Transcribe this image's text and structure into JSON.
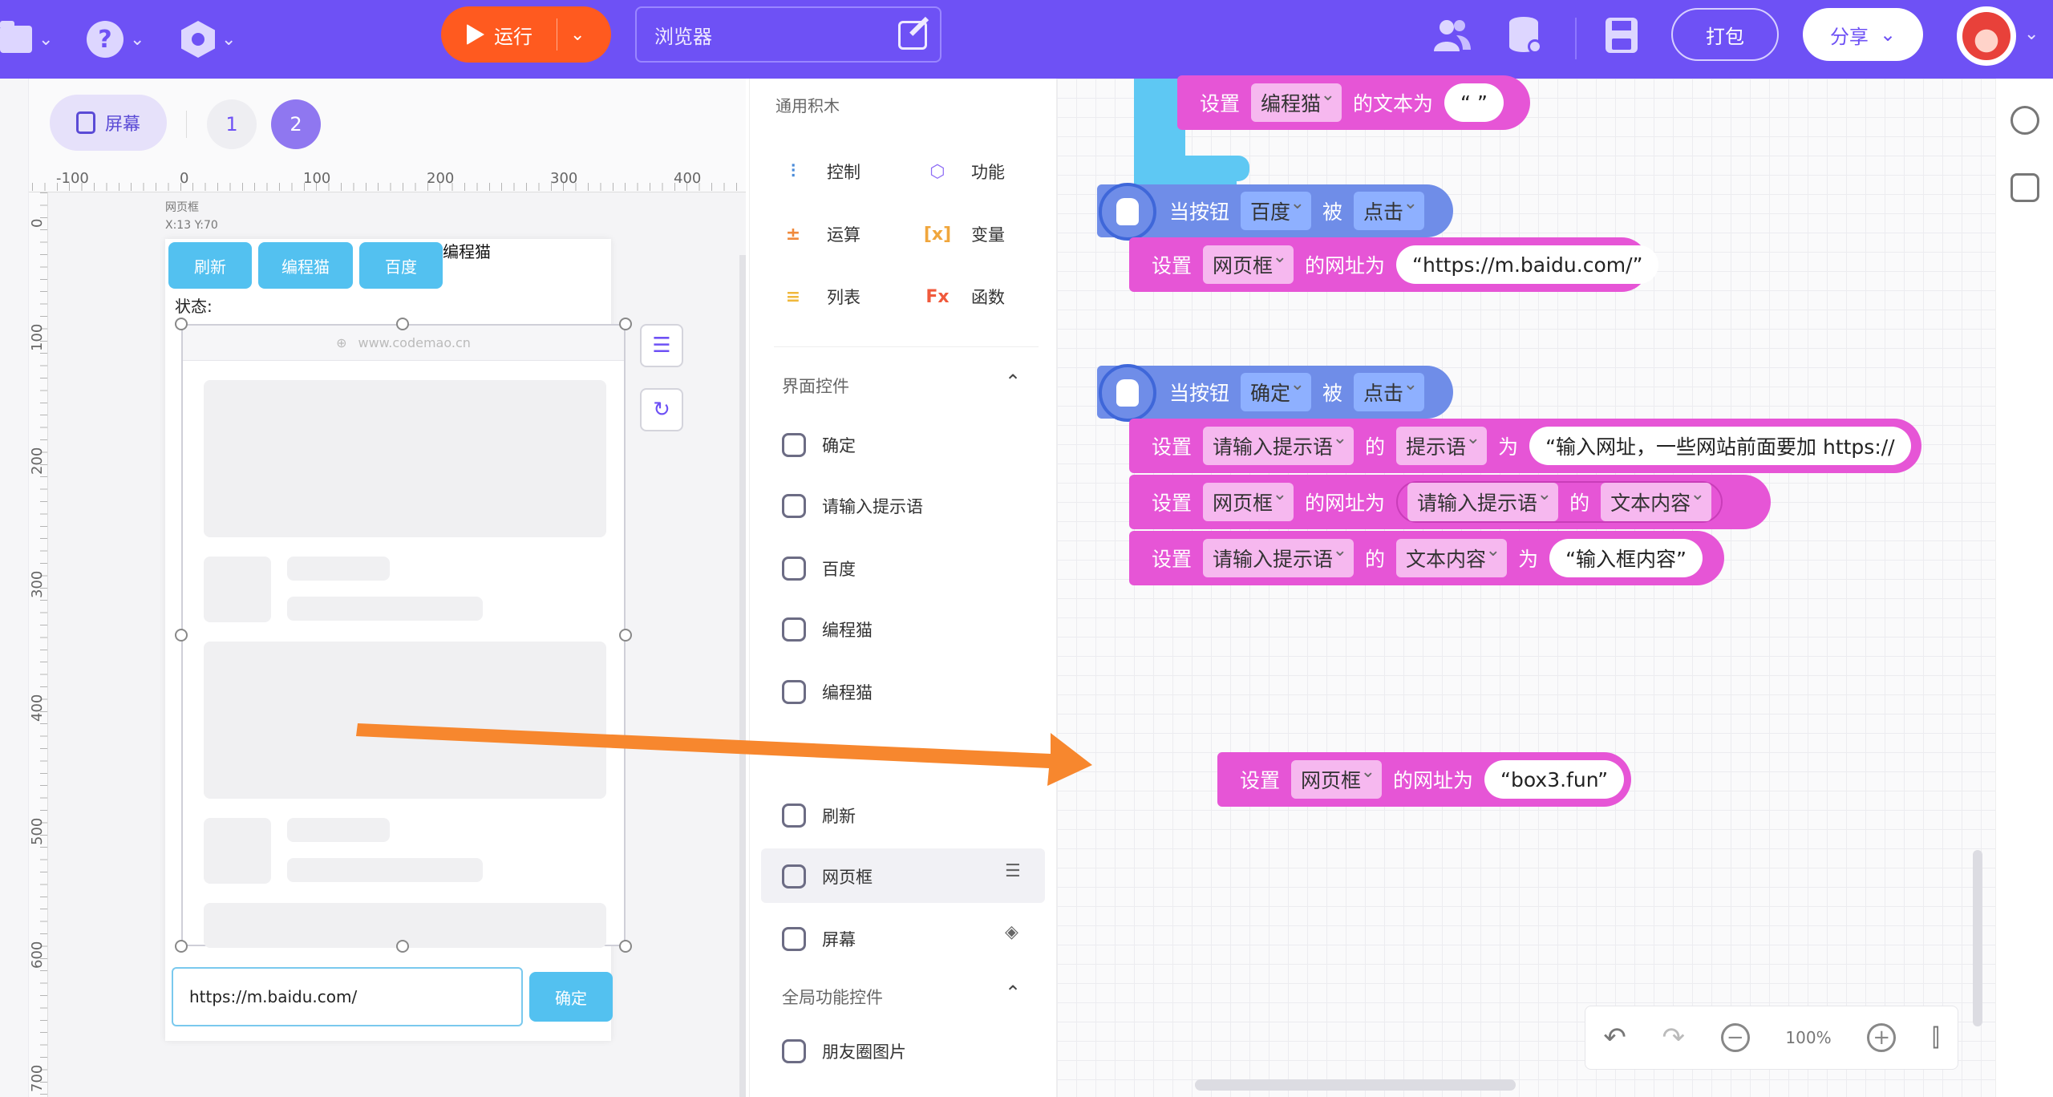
{
  "topbar": {
    "run_label": "运行",
    "browser_title": "浏览器",
    "pack_label": "打包",
    "share_label": "分享"
  },
  "stage": {
    "screen_label": "屏幕",
    "pages": [
      "1",
      "2"
    ],
    "ruler_h": [
      "-100",
      "0",
      "100",
      "200",
      "300",
      "400"
    ],
    "ruler_v": [
      "0",
      "100",
      "200",
      "300",
      "400",
      "500",
      "600",
      "700"
    ],
    "selected_name": "网页框",
    "selected_coord": "X:13 Y:70",
    "buttons": [
      "刷新",
      "编程猫",
      "百度"
    ],
    "label_cat": "编程猫",
    "label_status": "状态:",
    "webview_url": "www.codemao.cn",
    "input_value": "https://m.baidu.com/",
    "ok_label": "确定"
  },
  "palette": {
    "general_title": "通用积木",
    "categories": [
      {
        "label": "控制",
        "color": "#4a8bd9"
      },
      {
        "label": "功能",
        "color": "#8d6cf5"
      },
      {
        "label": "运算",
        "color": "#f08a3c"
      },
      {
        "label": "变量",
        "color": "#f0a63c"
      },
      {
        "label": "列表",
        "color": "#f0b83c"
      },
      {
        "label": "函数",
        "color": "#f05a3c"
      }
    ],
    "ui_section": "界面控件",
    "components": [
      "确定",
      "请输入提示语",
      "百度",
      "编程猫",
      "编程猫",
      "刷新",
      "网页框",
      "屏幕"
    ],
    "global_section": "全局功能控件",
    "global_components": [
      "朋友圈图片"
    ]
  },
  "code": {
    "set": "设置",
    "b0_target": "编程猫",
    "b0_prop": "的文本为",
    "b0_value": "“ ”",
    "when_button": "当按钮",
    "be": "被",
    "clicked": "点击",
    "e1_target": "百度",
    "e1_set_target": "网页框",
    "url_prop": "的网址为",
    "e1_url": "“https://m.baidu.com/”",
    "e2_target": "确定",
    "e2_r1_target": "请输入提示语",
    "of": "的",
    "hint_prop": "提示语",
    "to": "为",
    "e2_r1_value": "“输入网址，一些网站前面要加 https://",
    "e2_r2_target": "网页框",
    "e2_r2_src": "请输入提示语",
    "text_prop": "文本内容",
    "e2_r3_target": "请输入提示语",
    "e2_r3_value": "“输入框内容”",
    "loose_target": "网页框",
    "loose_value": "“box3.fun”"
  },
  "zoom": {
    "level": "100%"
  }
}
